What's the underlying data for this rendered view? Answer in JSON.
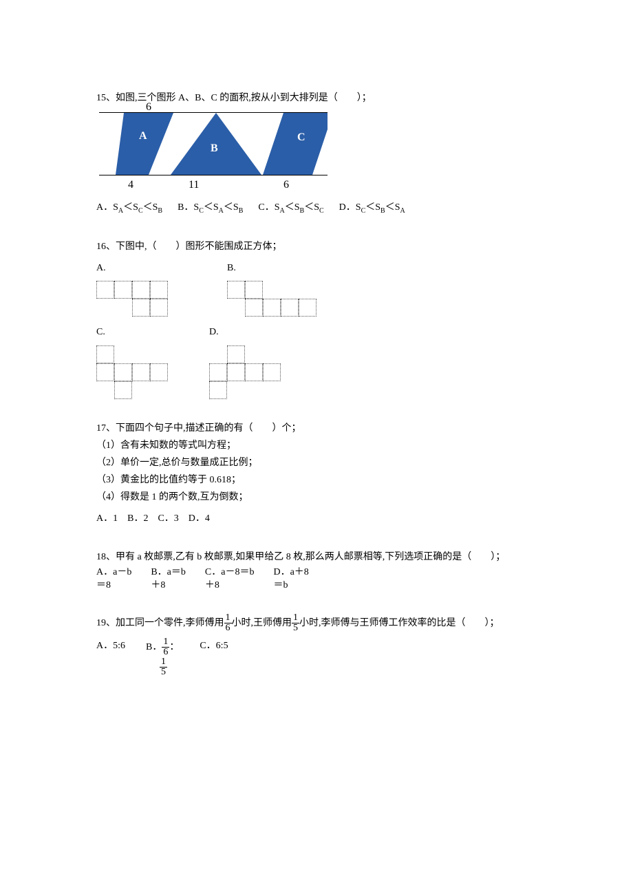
{
  "q15": {
    "stem": "15、如图,三个图形 A、B、C 的面积,按从小到大排列是（　　）；",
    "top_label": "6",
    "bottom_labels": [
      "4",
      "11",
      "6"
    ],
    "shape_labels": [
      "A",
      "B",
      "C"
    ],
    "options": {
      "A": "A．S<sub>A</sub>＜S<sub>C</sub>＜S<sub>B</sub>",
      "B": "B．S<sub>C</sub>＜S<sub>A</sub>＜S<sub>B</sub>",
      "C": "C．S<sub>A</sub>＜S<sub>B</sub>＜S<sub>C</sub>",
      "D": "D．S<sub>C</sub>＜S<sub>B</sub>＜S<sub>A</sub>"
    }
  },
  "q16": {
    "stem": "16、下图中,（　　）图形不能围成正方体；",
    "labels": [
      "A.",
      "B.",
      "C.",
      "D."
    ]
  },
  "q17": {
    "stem": "17、下面四个句子中,描述正确的有（　　）个；",
    "items": [
      "（1）含有未知数的等式叫方程；",
      "（2）单价一定,总价与数量成正比例；",
      "（3）黄金比的比值约等于 0.618；",
      "（4）得数是 1 的两个数,互为倒数；"
    ],
    "opts": "A．1　B．2　C．3　D．4"
  },
  "q18": {
    "stem": "18、甲有 a 枚邮票,乙有 b 枚邮票,如果甲给乙 8 枚,那么两人邮票相等,下列选项正确的是（　　）；",
    "options": {
      "A": [
        "A．a－b",
        "＝8"
      ],
      "B": [
        "B．a＝b",
        "＋8"
      ],
      "C": [
        "C．a－8＝b",
        "＋8"
      ],
      "D": [
        "D．a＋8",
        "＝b"
      ]
    }
  },
  "q19": {
    "pre": "19、加工同一个零件,李师傅用",
    "mid": "小时,王师傅用",
    "post": "小时,李师傅与王师傅工作效率的比是（　　）；",
    "f1n": "1",
    "f1d": "6",
    "f2n": "1",
    "f2d": "5",
    "optA": "A．5:6",
    "optBprefix": "B．",
    "optBcolon": "：",
    "optC": "C．6:5"
  }
}
